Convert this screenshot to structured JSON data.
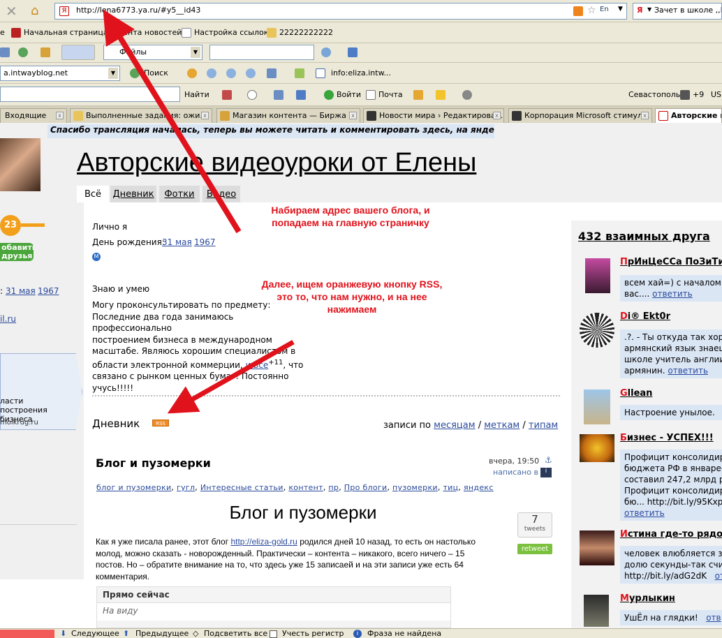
{
  "browser": {
    "address": "http://lena6773.ya.ru/#y5__id43",
    "search_engine": "Я",
    "search_value": "Зачет в школе ,,Б...",
    "bookmarks": [
      "е",
      "Начальная страница",
      "Лента новостей",
      "Настройка ссылок",
      "22222222222"
    ],
    "toolbar2_dropdown": "Файлы",
    "toolbar3_url": "a.intwayblog.net",
    "toolbar3_search": "Поиск",
    "toolbar3_info": "info:eliza.intw...",
    "toolbar4_find": "Найти",
    "toolbar4_login": "Войти",
    "toolbar4_mail": "Почта",
    "toolbar4_city": "Севастополь",
    "toolbar4_temp": "+9",
    "toolbar4_usd": "USI",
    "tabs": [
      "Входящие",
      "Выполненные задания: ожи...",
      "Магазин контента — Биржа ...",
      "Новости мира › Редактирова...",
      "Корпорация Microsoft стимул...",
      "Авторские в..."
    ]
  },
  "blog": {
    "notice": "Спасибо трансляция началась, теперь вы можете читать и комментировать здесь, на яндекс блоге",
    "title": "Авторские видеоуроки от Елены",
    "nav": [
      "Всё",
      "Дневник",
      "Фотки",
      "Видео"
    ],
    "level": "23",
    "add_friend": "обавить друзья",
    "left_birth_day": "31 мая",
    "left_birth_year": "1967",
    "left_birth_prefix": ":",
    "left_link": "il.ru",
    "moikrug_text": "ласти построения бизнеса",
    "moikrug_link": "moikrug.ru",
    "personal_label": "Лично я",
    "birthday_label": "День рождения:",
    "birthday_day": "31 мая",
    "birthday_year": "1967",
    "skills_label": "Знаю и умею",
    "skills_text_1": "Могу проконсультировать по предмету:",
    "skills_text_2": "Последние два года занимаюсь профессионально",
    "skills_text_3": "построением бизнеса в международном",
    "skills_text_4": "масштабе. Являюсь хорошим специалистом в",
    "skills_text_5": "области электронной коммерции,",
    "skills_link": "и все",
    "skills_sup": "+11",
    "skills_text_6": ", что",
    "skills_text_7": "связано с рынком ценных бумаг! Постоянно",
    "skills_text_8": "учусь!!!!!",
    "diary_label": "Дневник",
    "rss": "RSS",
    "records_by": "записи по",
    "records_months": "месяцам",
    "records_tags": "меткам",
    "records_types": "типам",
    "records_sep": "/",
    "post_title": "Блог и пузомерки",
    "post_time": "вчера, 19:50",
    "post_written": "написано в",
    "post_tags": [
      "блог и пузомерки",
      "гугл",
      "Интересные статьи",
      "контент",
      "пр",
      "Про блоги",
      "пузомерки",
      "тиц",
      "яндекс"
    ],
    "post_heading": "Блог и пузомерки",
    "tweets_count": "7",
    "tweets_label": "tweets",
    "retweet": "retweet",
    "post_text_1": "Как я уже писала ранее, этот блог",
    "post_link": "http://eliza-gold.ru",
    "post_text_2": "родился дней 10 назад, то есть он настолько",
    "post_text_3": "молод, можно сказать -  новорожденный. Практически – контента – никакого, всего ничего – 15",
    "post_text_4": "постов.  Но – обратите внимание на то,  что  здесь уже 15 записаей  и на эти  записи уже есть 64",
    "post_text_5": "комментария.",
    "now_label": "Прямо сейчас",
    "now_value": "На виду"
  },
  "annotations": {
    "top": "Набираем адрес вашего блога, и попадаем на главную страничку",
    "middle": "Далее, ищем  оранжевую кнопку RSS, это то, что нам нужно, и на нее нажимаем",
    "arrow_color": "#e0121b"
  },
  "friends": {
    "header": "432 взаимных друга",
    "items": [
      {
        "initial": "П",
        "rest": "рИнЦеССа ПоЗиТи",
        "text1": "всем хай=) с началом н",
        "text2": "вас....",
        "link": "ответить"
      },
      {
        "initial": "D",
        "rest": "i® Ekt0r",
        "text1": ".?. - Ты откуда так хоро",
        "text2": "армянский язык знаеш",
        "text3": "школе учитель англиис",
        "text4": "армянин.",
        "link": "ответить"
      },
      {
        "initial": "G",
        "rest": "llean",
        "text1": "Настроение унылое.",
        "link": "ответить"
      },
      {
        "initial": "Б",
        "rest": "изнес - УСПЕХ!!!",
        "text1": "Профицит консолидиро",
        "text2": "бюджета РФ в январе-",
        "text3": "составил 247,2 млрд ру",
        "text4": "Профицит консолидиро",
        "text5": "бю... http://bit.ly/95KxpF",
        "link": "ответить"
      },
      {
        "initial": "И",
        "rest": "стина где-то рядо",
        "text1": "человек влюбляется за",
        "text2": "долю секунды-так счит",
        "text3": "http://bit.ly/adG2dK",
        "link": "от"
      },
      {
        "initial": "М",
        "rest": "урлыкин",
        "text1": "УшЁл на глядки!",
        "link": "отв"
      }
    ]
  },
  "statusbar": {
    "next": "Следующее",
    "prev": "Предыдущее",
    "highlight": "Подсветить все",
    "case": "Учесть регистр",
    "not_found": "Фраза не найдена"
  }
}
